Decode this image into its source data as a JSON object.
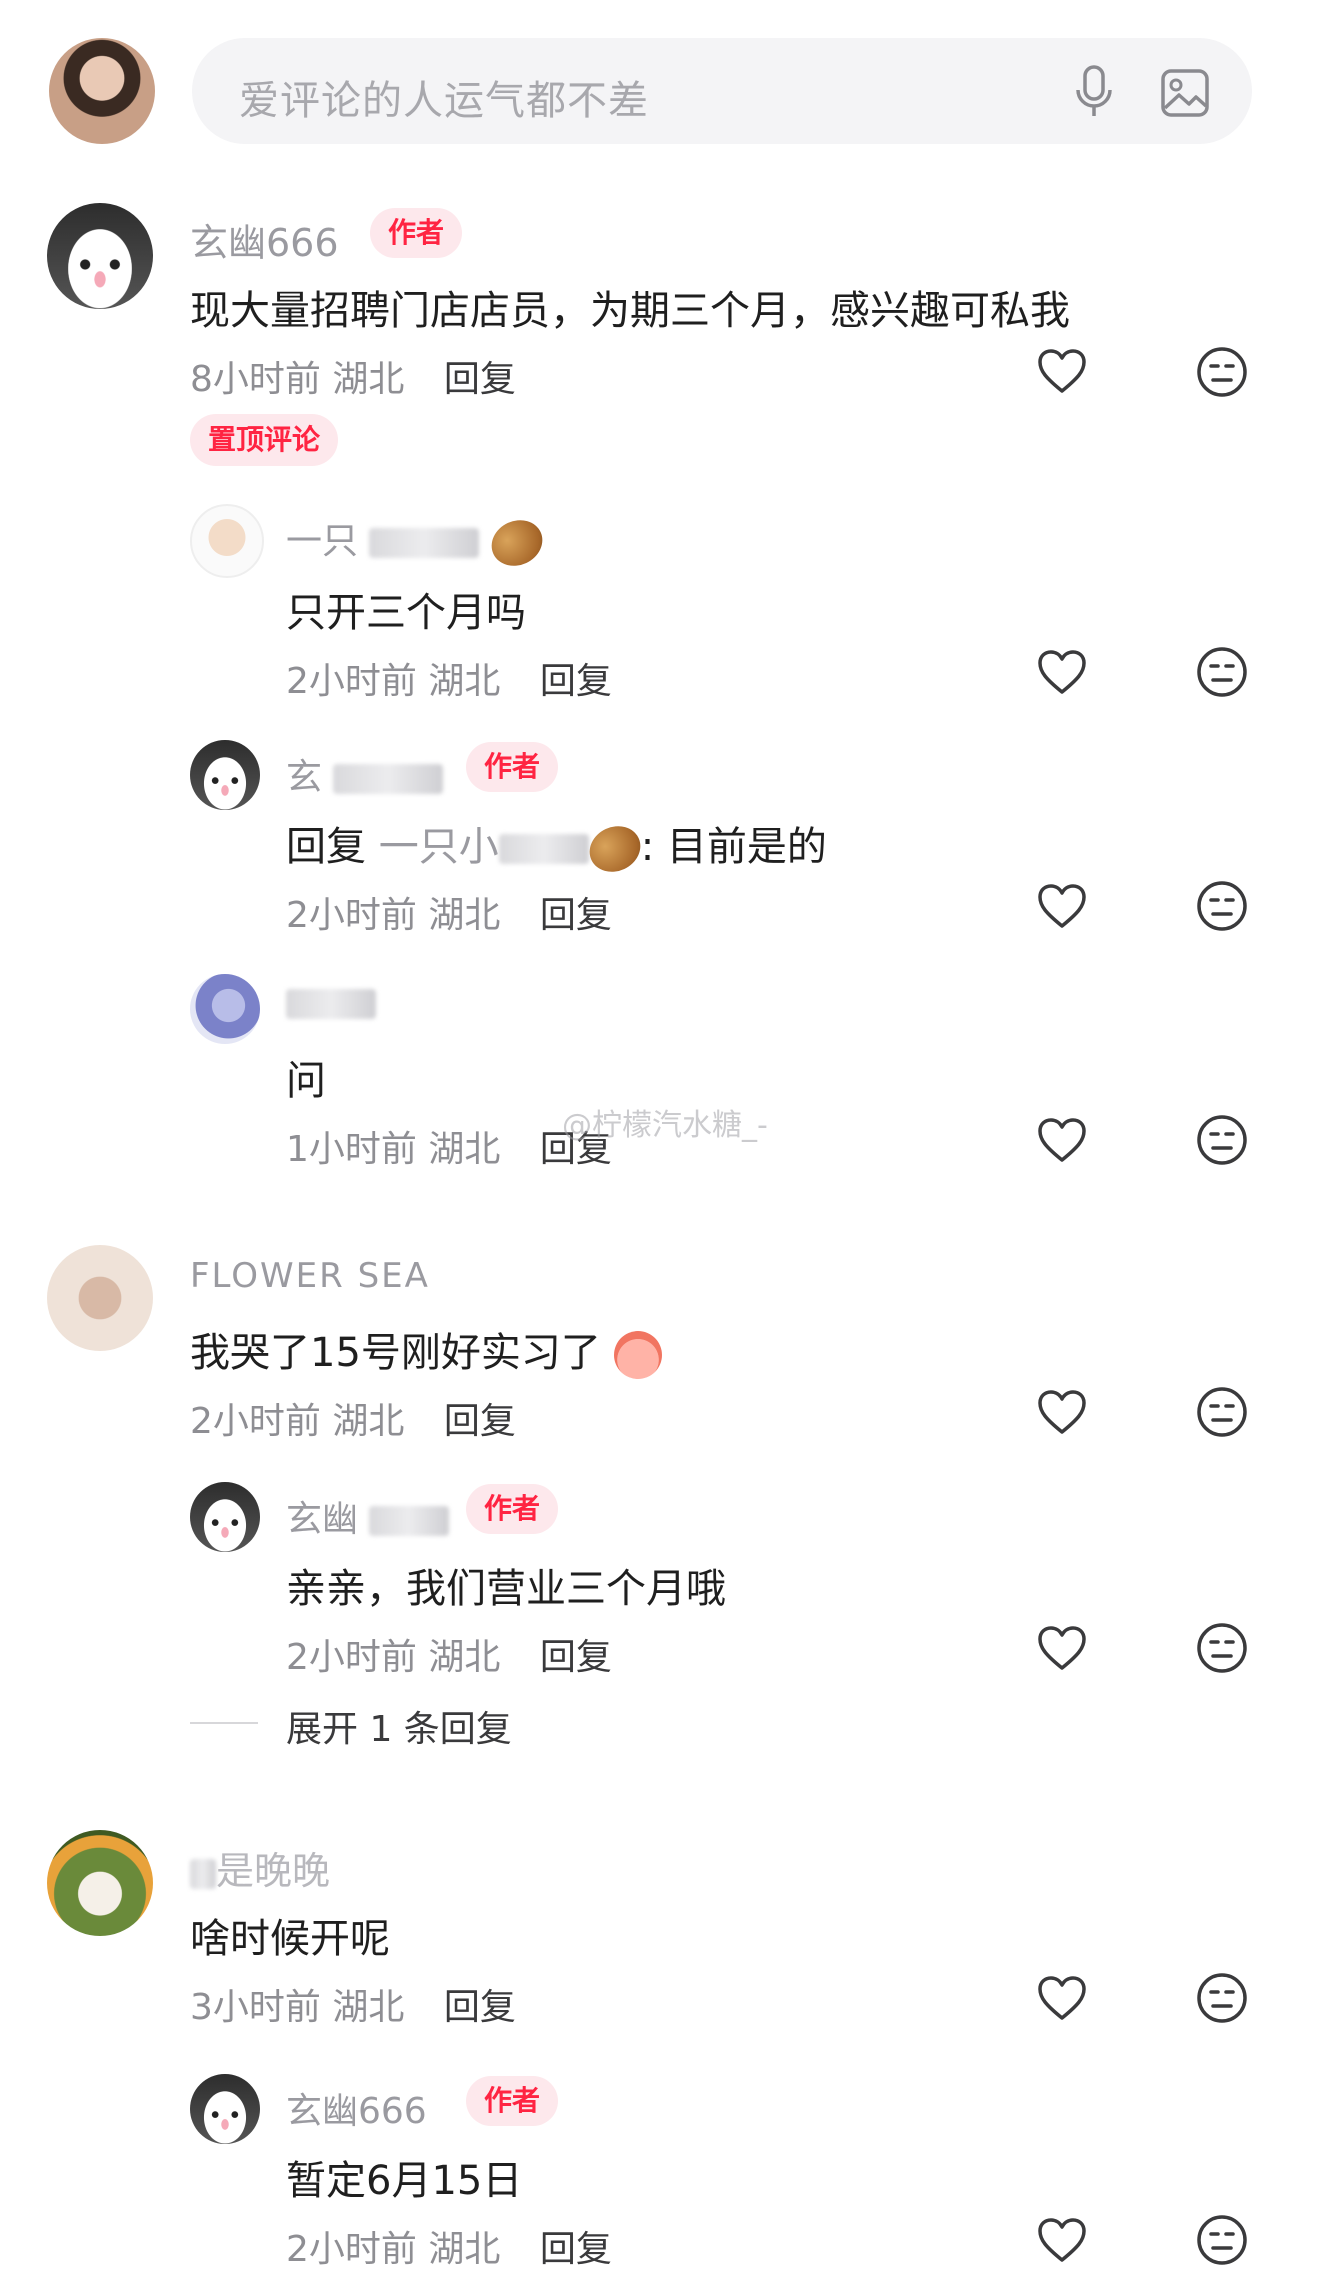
{
  "search": {
    "placeholder": "爱评论的人运气都不差"
  },
  "badges": {
    "author": "作者",
    "pinned": "置顶评论"
  },
  "reply_label": "回复",
  "watermark": "@柠檬汽水糖_-",
  "comments": [
    {
      "name": "玄幽666",
      "text": "现大量招聘门店店员，为期三个月，感兴趣可私我",
      "time": "8小时前",
      "location": "湖北",
      "pinned": true,
      "replies": [
        {
          "name": "一只",
          "text": "只开三个月吗",
          "time": "2小时前",
          "location": "湖北"
        },
        {
          "name": "玄",
          "reply_prefix": "回复",
          "reply_to": "一只小",
          "text_suffix": ": 目前是的",
          "time": "2小时前",
          "location": "湖北"
        },
        {
          "name": "",
          "text": "问",
          "time": "1小时前",
          "location": "湖北"
        }
      ]
    },
    {
      "name": "FLOWER SEA",
      "text": "我哭了15号刚好实习了",
      "time": "2小时前",
      "location": "湖北",
      "replies": [
        {
          "name": "玄幽",
          "text": "亲亲，我们营业三个月哦",
          "time": "2小时前",
          "location": "湖北"
        }
      ],
      "expand_label": "展开 1 条回复"
    },
    {
      "name": "是晚晚",
      "text": "啥时候开呢",
      "time": "3小时前",
      "location": "湖北",
      "replies": [
        {
          "name": "玄幽666",
          "text": "暂定6月15日",
          "time": "2小时前",
          "location": "湖北"
        }
      ]
    }
  ],
  "icons": {
    "like": "heart-outline-icon",
    "dislike": "neutral-face-icon",
    "voice": "microphone-icon",
    "image": "image-icon"
  },
  "colors": {
    "accent": "#ff2442",
    "badge_bg": "#fde8ec",
    "muted": "#8e8e93"
  }
}
